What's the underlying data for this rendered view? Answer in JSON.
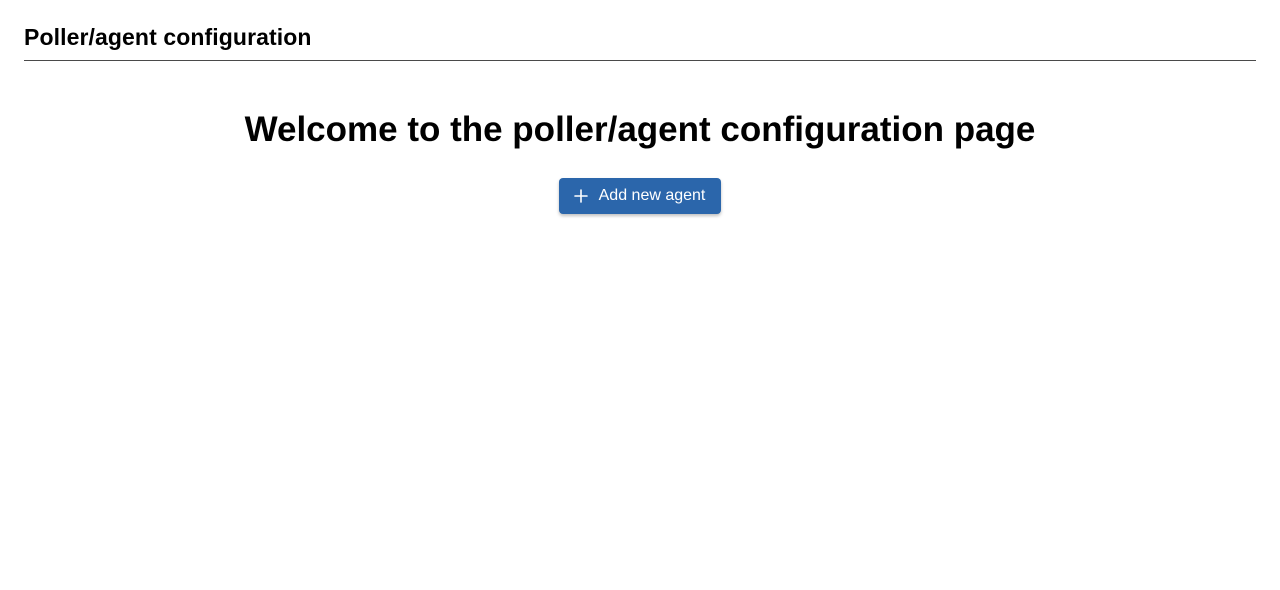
{
  "header": {
    "title": "Poller/agent configuration"
  },
  "main": {
    "heading": "Welcome to the poller/agent configuration page",
    "add_button": {
      "label": "Add new agent",
      "icon": "plus-icon"
    }
  },
  "colors": {
    "accent": "#2b66ab",
    "divider": "#4a4a4a"
  }
}
